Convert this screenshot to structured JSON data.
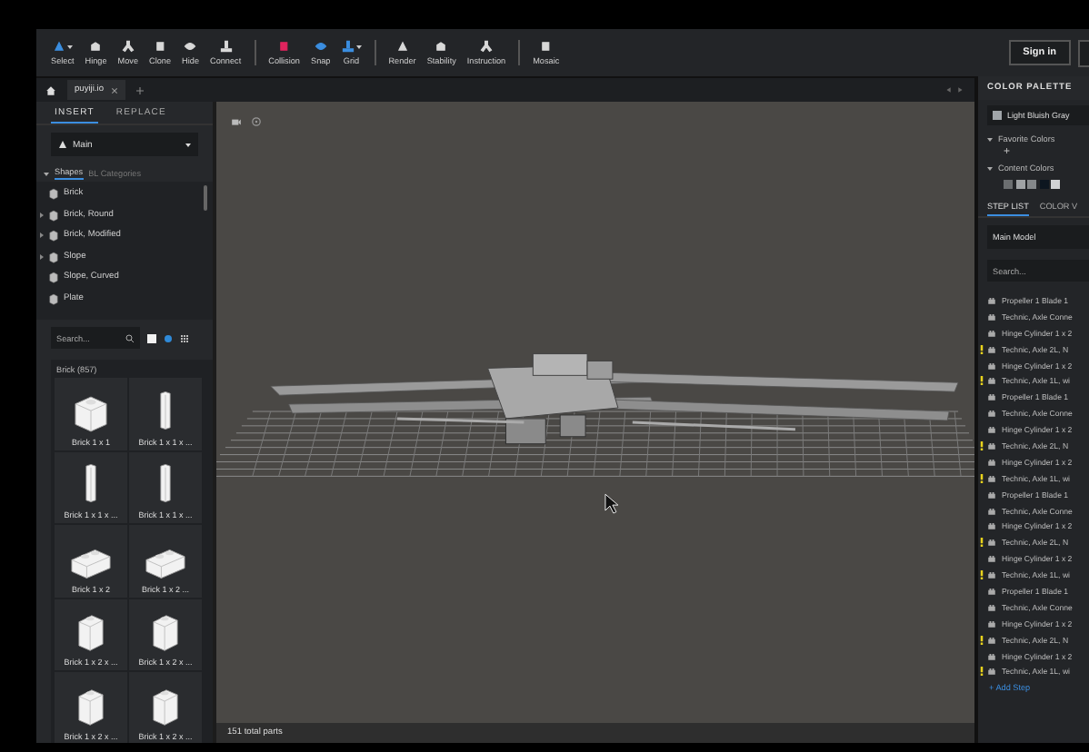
{
  "toolbar": {
    "groups": [
      {
        "tools": [
          {
            "label": "Select",
            "color": "#3b8ee0",
            "dropdown": true
          },
          {
            "label": "Hinge",
            "color": "#d8d8d8",
            "dropdown": false
          },
          {
            "label": "Move",
            "color": "#d8d8d8",
            "dropdown": false
          },
          {
            "label": "Clone",
            "color": "#d8d8d8",
            "dropdown": false
          },
          {
            "label": "Hide",
            "color": "#d8d8d8",
            "dropdown": false
          },
          {
            "label": "Connect",
            "color": "#d8d8d8",
            "dropdown": false
          }
        ]
      },
      {
        "tools": [
          {
            "label": "Collision",
            "color": "#e0245e",
            "dropdown": false
          },
          {
            "label": "Snap",
            "color": "#3b8ee0",
            "dropdown": false
          },
          {
            "label": "Grid",
            "color": "#3b8ee0",
            "dropdown": true
          }
        ]
      },
      {
        "tools": [
          {
            "label": "Render",
            "color": "#d8d8d8",
            "dropdown": false
          },
          {
            "label": "Stability",
            "color": "#d8d8d8",
            "dropdown": false
          },
          {
            "label": "Instruction",
            "color": "#d8d8d8",
            "dropdown": false
          }
        ]
      },
      {
        "tools": [
          {
            "label": "Mosaic",
            "color": "#d8d8d8",
            "dropdown": false
          }
        ]
      }
    ],
    "sign_in": "Sign in"
  },
  "tabs": [
    {
      "label": "puyiji.io",
      "selected": true
    }
  ],
  "insert_panel": {
    "tabs": [
      {
        "label": "INSERT",
        "selected": true
      },
      {
        "label": "REPLACE",
        "selected": false
      }
    ],
    "set": "Main",
    "modes": [
      {
        "label": "Shapes",
        "selected": true
      },
      {
        "label": "BL Categories",
        "selected": false
      }
    ],
    "categories": [
      {
        "label": "Brick",
        "expandable": false
      },
      {
        "label": "Brick, Round",
        "expandable": true
      },
      {
        "label": "Brick, Modified",
        "expandable": true
      },
      {
        "label": "Slope",
        "expandable": true
      },
      {
        "label": "Slope, Curved",
        "expandable": false
      },
      {
        "label": "Plate",
        "expandable": false
      }
    ],
    "search": {
      "placeholder": "Search..."
    },
    "parts_heading": "Brick (857)",
    "parts": [
      "Brick 1 x 1",
      "Brick 1 x 1 x ...",
      "Brick 1 x 1 x ...",
      "Brick 1 x 1 x ...",
      "Brick 1 x 2",
      "Brick 1 x 2 ...",
      "Brick 1 x 2 x ...",
      "Brick 1 x 2 x ...",
      "Brick 1 x 2 x ...",
      "Brick 1 x 2 x ..."
    ]
  },
  "viewport": {
    "status": "151 total parts"
  },
  "color_palette": {
    "title": "COLOR PALETTE",
    "current": {
      "name": "Light Bluish Gray",
      "color": "#a0a5a9"
    },
    "favorites": {
      "label": "Favorite Colors",
      "add": "+"
    },
    "content": {
      "label": "Content Colors",
      "swatches": [
        {
          "color": "#6b6e70"
        },
        {
          "color": "#a0a3a5"
        },
        {
          "color": "#85888a"
        },
        {
          "color": "#0d1620"
        },
        {
          "color": "#d0d2d4"
        }
      ]
    }
  },
  "step_panel": {
    "tabs": [
      {
        "label": "STEP LIST",
        "selected": true
      },
      {
        "label": "COLOR V",
        "selected": false
      }
    ],
    "model": "Main Model",
    "search": {
      "placeholder": "Search..."
    },
    "steps": [
      {
        "label": "Propeller 1 Blade 1",
        "warning": false
      },
      {
        "label": "Technic, Axle Conne",
        "warning": false
      },
      {
        "label": "Hinge Cylinder 1 x 2",
        "warning": false
      },
      {
        "label": "Technic, Axle 2L, N",
        "warning": true
      },
      {
        "label": "Hinge Cylinder 1 x 2",
        "warning": false
      },
      {
        "label": "Technic, Axle 1L, wi",
        "warning": true
      },
      {
        "label": "Propeller 1 Blade 1",
        "warning": false
      },
      {
        "label": "Technic, Axle Conne",
        "warning": false
      },
      {
        "label": "Hinge Cylinder 1 x 2",
        "warning": false
      },
      {
        "label": "Technic, Axle 2L, N",
        "warning": true
      },
      {
        "label": "Hinge Cylinder 1 x 2",
        "warning": false
      },
      {
        "label": "Technic, Axle 1L, wi",
        "warning": true
      },
      {
        "label": "Propeller 1 Blade 1",
        "warning": false
      },
      {
        "label": "Technic, Axle Conne",
        "warning": false
      },
      {
        "label": "Hinge Cylinder 1 x 2",
        "warning": false
      },
      {
        "label": "Technic, Axle 2L, N",
        "warning": true
      },
      {
        "label": "Hinge Cylinder 1 x 2",
        "warning": false
      },
      {
        "label": "Technic, Axle 1L, wi",
        "warning": true
      },
      {
        "label": "Propeller 1 Blade 1",
        "warning": false
      },
      {
        "label": "Technic, Axle Conne",
        "warning": false
      },
      {
        "label": "Hinge Cylinder 1 x 2",
        "warning": false
      },
      {
        "label": "Technic, Axle 2L, N",
        "warning": true
      },
      {
        "label": "Hinge Cylinder 1 x 2",
        "warning": false
      },
      {
        "label": "Technic, Axle 1L, wi",
        "warning": true
      }
    ],
    "add_step": "+ Add Step"
  }
}
